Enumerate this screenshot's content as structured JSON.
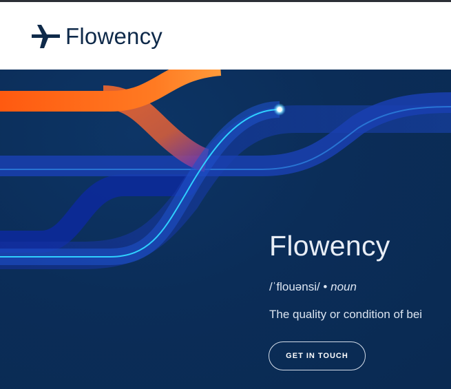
{
  "brand": {
    "name": "Flowency",
    "logo_icon": "plane-arrow-icon",
    "color": "#0f2a4a"
  },
  "hero": {
    "title": "Flowency",
    "phonetic": "/ˈflouənsi/ •",
    "part_of_speech": "noun",
    "definition": "The quality or condition of bei",
    "cta_label": "GET IN TOUCH",
    "colors": {
      "background": "#0b2d58",
      "orange_stream": "#ff6a1a",
      "blue_stream": "#1a3fb0",
      "cyan_line": "#2fd0ff"
    }
  }
}
